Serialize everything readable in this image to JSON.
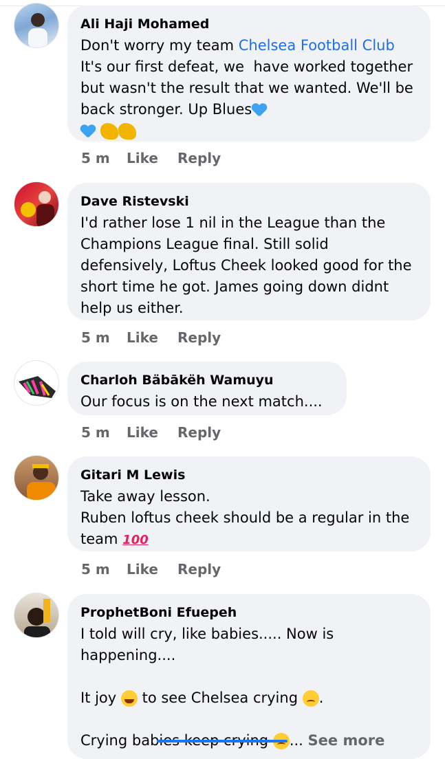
{
  "comments": [
    {
      "author": "Ali Haji Mohamed",
      "text_prefix": "Don't worry my team ",
      "mention": "Chelsea Football Club",
      "text_suffix": "\nIt's our first defeat, we  have worked together but wasn't the result that we wanted. We'll be back stronger. Up Blues",
      "time": "5 m",
      "like": "Like",
      "reply": "Reply"
    },
    {
      "author": "Dave Ristevski",
      "text": "I'd rather lose 1 nil in the League than the Champions League final. Still solid defensively, Loftus Cheek looked good for the short time he got. James going down didnt help us either.",
      "time": "5 m",
      "like": "Like",
      "reply": "Reply"
    },
    {
      "author": "Charloh Bäbākëh Wamuyu",
      "text": "Our focus is on the next match....",
      "time": "5 m",
      "like": "Like",
      "reply": "Reply"
    },
    {
      "author": "Gitari M Lewis",
      "text": "Take away lesson.\nRuben loftus cheek should be a regular in the team",
      "emoji_100": "100",
      "time": "5 m",
      "like": "Like",
      "reply": "Reply"
    },
    {
      "author": "ProphetBoni Efuepeh",
      "line1": "I told will cry, like babies..... Now is happening....",
      "line2_a": "It joy",
      "line2_b": "to see Chelsea crying",
      "line2_c": ".",
      "line3": "Crying babies keep crying",
      "ellipsis": "...",
      "see_more": "See more"
    }
  ],
  "colors": {
    "bubble": "#f0f2f5",
    "link": "#216fdb",
    "meta": "#65676b",
    "heart": "#3ba3f0"
  }
}
